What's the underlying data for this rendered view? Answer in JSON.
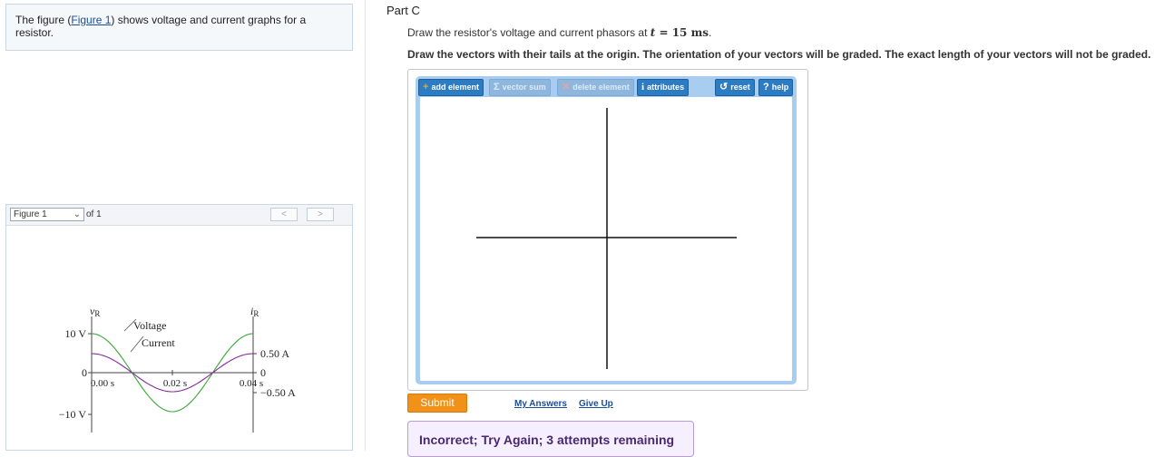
{
  "intro": {
    "text_before": "The figure (",
    "link": "Figure 1",
    "text_after": ") shows voltage and current graphs for a resistor."
  },
  "figure_panel": {
    "selected": "Figure 1",
    "of_text": "of 1",
    "prev_icon": "<",
    "next_icon": ">"
  },
  "figure": {
    "vr_label": "v",
    "vr_sub": "R",
    "ir_label": "i",
    "ir_sub": "R",
    "v_pos": "10 V",
    "v_zero": "0",
    "v_neg": "−10 V",
    "i_pos": "0.50 A",
    "i_zero": "0",
    "i_neg": "−0.50 A",
    "t0": "0.00 s",
    "t1": "0.02 s",
    "t2": "0.04 s",
    "legend_voltage": "Voltage",
    "legend_current": "Current",
    "colors": {
      "voltage": "#3aa63a",
      "current": "#8a2c9c"
    }
  },
  "part": {
    "title": "Part C",
    "instr_prefix": "Draw the resistor's voltage and current phasors at ",
    "t_var": "t",
    "t_eq": " = 15 ms",
    "instr_suffix": ".",
    "instr_bold": "Draw the vectors with their tails at the origin. The orientation of your vectors will be graded. The exact length of your vectors will not be graded."
  },
  "toolbar": {
    "add_element": "add element",
    "vector_sum": "vector sum",
    "delete_element": "delete element",
    "attributes": "attributes",
    "reset": "reset",
    "help": "help",
    "icons": {
      "add": "+",
      "sum": "Σ",
      "delete": "✕",
      "info": "i",
      "reset": "↺",
      "help": "?"
    }
  },
  "actions": {
    "submit": "Submit",
    "my_answers": "My Answers",
    "give_up": "Give Up"
  },
  "feedback": {
    "text": "Incorrect; Try Again; 3 attempts remaining"
  }
}
